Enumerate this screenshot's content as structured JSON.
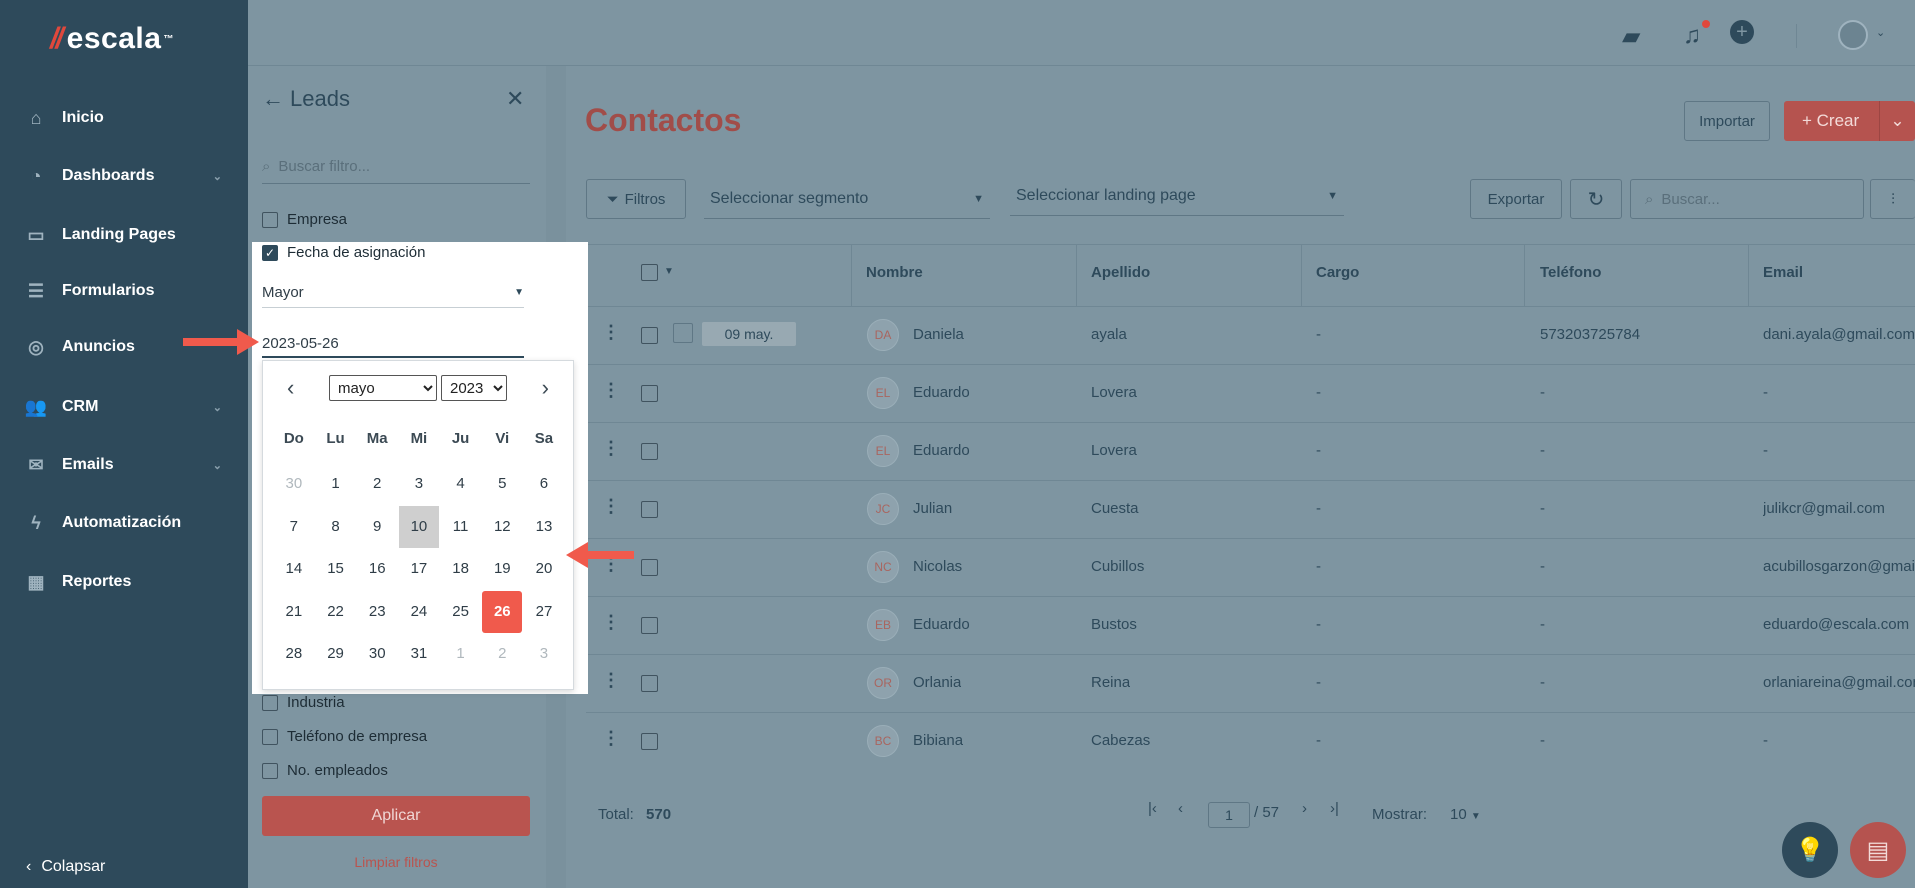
{
  "brand": {
    "name": "escala",
    "mark": "//",
    "tm": "™"
  },
  "sidebar": {
    "items": [
      {
        "label": "Inicio",
        "icon": "⌂",
        "chevron": false
      },
      {
        "label": "Dashboards",
        "icon": "◔",
        "chevron": true
      },
      {
        "label": "Landing Pages",
        "icon": "▭",
        "chevron": false
      },
      {
        "label": "Formularios",
        "icon": "☰",
        "chevron": false
      },
      {
        "label": "Anuncios",
        "icon": "◎",
        "chevron": false
      },
      {
        "label": "CRM",
        "icon": "👥",
        "chevron": true
      },
      {
        "label": "Emails",
        "icon": "✉",
        "chevron": true
      },
      {
        "label": "Automatización",
        "icon": "ϟ",
        "chevron": false
      },
      {
        "label": "Reportes",
        "icon": "▦",
        "chevron": false
      }
    ],
    "collapse_label": "Colapsar"
  },
  "filters": {
    "title": "Leads",
    "search_placeholder": "Buscar filtro...",
    "empresa": "Empresa",
    "fecha_asignacion": "Fecha de asignación",
    "operator": "Mayor",
    "date_value": "2023-05-26",
    "industria": "Industria",
    "telefono_empresa": "Teléfono de empresa",
    "no_empleados": "No. empleados",
    "apply": "Aplicar",
    "clear": "Limpiar filtros"
  },
  "calendar": {
    "month": "mayo",
    "year": "2023",
    "weekdays": [
      "Do",
      "Lu",
      "Ma",
      "Mi",
      "Ju",
      "Vi",
      "Sa"
    ],
    "days": [
      {
        "d": "30",
        "muted": true
      },
      {
        "d": "1"
      },
      {
        "d": "2"
      },
      {
        "d": "3"
      },
      {
        "d": "4"
      },
      {
        "d": "5"
      },
      {
        "d": "6"
      },
      {
        "d": "7"
      },
      {
        "d": "8"
      },
      {
        "d": "9"
      },
      {
        "d": "10",
        "today": true
      },
      {
        "d": "11"
      },
      {
        "d": "12"
      },
      {
        "d": "13"
      },
      {
        "d": "14"
      },
      {
        "d": "15"
      },
      {
        "d": "16"
      },
      {
        "d": "17"
      },
      {
        "d": "18"
      },
      {
        "d": "19"
      },
      {
        "d": "20"
      },
      {
        "d": "21"
      },
      {
        "d": "22"
      },
      {
        "d": "23"
      },
      {
        "d": "24"
      },
      {
        "d": "25"
      },
      {
        "d": "26",
        "selected": true
      },
      {
        "d": "27"
      },
      {
        "d": "28"
      },
      {
        "d": "29"
      },
      {
        "d": "30"
      },
      {
        "d": "31"
      },
      {
        "d": "1",
        "muted": true
      },
      {
        "d": "2",
        "muted": true
      },
      {
        "d": "3",
        "muted": true
      }
    ]
  },
  "main": {
    "title": "Contactos",
    "import_label": "Importar",
    "create_label": "+ Crear",
    "filters_label": "Filtros",
    "segment_placeholder": "Seleccionar segmento",
    "landing_placeholder": "Seleccionar landing page",
    "export_label": "Exportar",
    "search_placeholder": "Buscar...",
    "columns": [
      "Nombre",
      "Apellido",
      "Cargo",
      "Teléfono",
      "Email"
    ],
    "rows": [
      {
        "initials": "DA",
        "nombre": "Daniela",
        "apellido": "ayala",
        "cargo": "-",
        "telefono": "573203725784",
        "email": "dani.ayala@gmail.com",
        "date_tag": "09 may."
      },
      {
        "initials": "EL",
        "nombre": "Eduardo",
        "apellido": "Lovera",
        "cargo": "-",
        "telefono": "-",
        "email": "-"
      },
      {
        "initials": "EL",
        "nombre": "Eduardo",
        "apellido": "Lovera",
        "cargo": "-",
        "telefono": "-",
        "email": "-"
      },
      {
        "initials": "JC",
        "nombre": "Julian",
        "apellido": "Cuesta",
        "cargo": "-",
        "telefono": "-",
        "email": "julikcr@gmail.com"
      },
      {
        "initials": "NC",
        "nombre": "Nicolas",
        "apellido": "Cubillos",
        "cargo": "-",
        "telefono": "-",
        "email": "acubillosgarzon@gmail.com"
      },
      {
        "initials": "EB",
        "nombre": "Eduardo",
        "apellido": "Bustos",
        "cargo": "-",
        "telefono": "-",
        "email": "eduardo@escala.com"
      },
      {
        "initials": "OR",
        "nombre": "Orlania",
        "apellido": "Reina",
        "cargo": "-",
        "telefono": "-",
        "email": "orlaniareina@gmail.com"
      },
      {
        "initials": "BC",
        "nombre": "Bibiana",
        "apellido": "Cabezas",
        "cargo": "-",
        "telefono": "-",
        "email": "-"
      }
    ],
    "total_label": "Total:",
    "total_value": "570",
    "page_current": "1",
    "page_total": "/ 57",
    "show_label": "Mostrar:",
    "show_value": "10"
  },
  "colors": {
    "accent": "#f05a4c",
    "sidebar": "#2e4a5b",
    "overlay": "#7e95a1"
  }
}
